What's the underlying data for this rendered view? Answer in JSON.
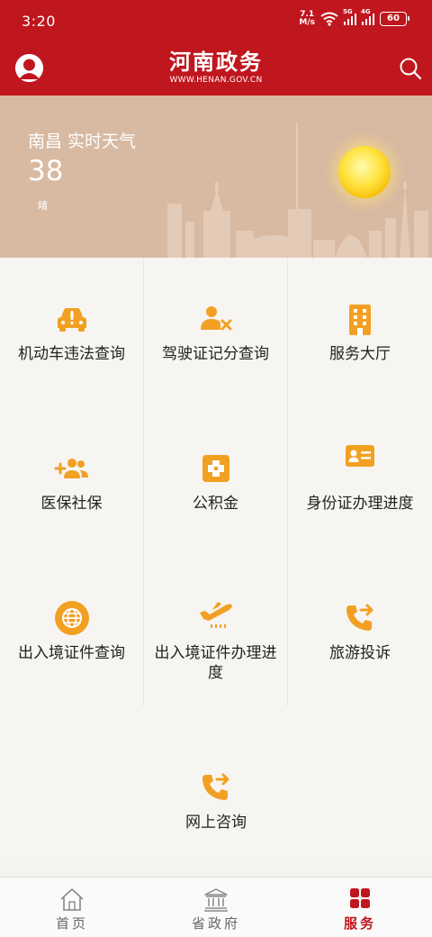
{
  "status_bar": {
    "time": "3:20",
    "net_speed_value": "7.1",
    "net_speed_unit": "M/s",
    "sim1_label": "5G",
    "sim2_label": "4G",
    "battery": "60"
  },
  "header": {
    "title": "河南政务",
    "url": "WWW.HENAN.GOV.CN",
    "avatar_icon": "user-avatar-icon",
    "search_icon": "search-icon"
  },
  "weather": {
    "city_title": "南昌 实时天气",
    "temperature": "38",
    "condition": "晴"
  },
  "services": [
    {
      "label": "机动车违法查询",
      "icon": "car-alert-icon"
    },
    {
      "label": "驾驶证记分查询",
      "icon": "user-remove-icon"
    },
    {
      "label": "服务大厅",
      "icon": "building-icon"
    },
    {
      "label": "医保社保",
      "icon": "add-users-icon"
    },
    {
      "label": "公积金",
      "icon": "medical-cross-icon"
    },
    {
      "label": "身份证办理进度",
      "icon": "id-card-icon"
    },
    {
      "label": "出入境证件查询",
      "icon": "globe-icon"
    },
    {
      "label": "出入境证件办理进度",
      "icon": "airplane-takeoff-icon"
    },
    {
      "label": "旅游投诉",
      "icon": "phone-forward-icon"
    },
    {
      "label": "网上咨询",
      "icon": "phone-forward-icon"
    }
  ],
  "bottom_nav": [
    {
      "label": "首页",
      "icon": "home-icon"
    },
    {
      "label": "省政府",
      "icon": "government-building-icon"
    },
    {
      "label": "服务",
      "icon": "grid-icon",
      "active": true
    }
  ],
  "colors": {
    "brand_red": "#c0161e",
    "icon_orange": "#f2a023",
    "weather_bg": "#d8b9a2"
  }
}
